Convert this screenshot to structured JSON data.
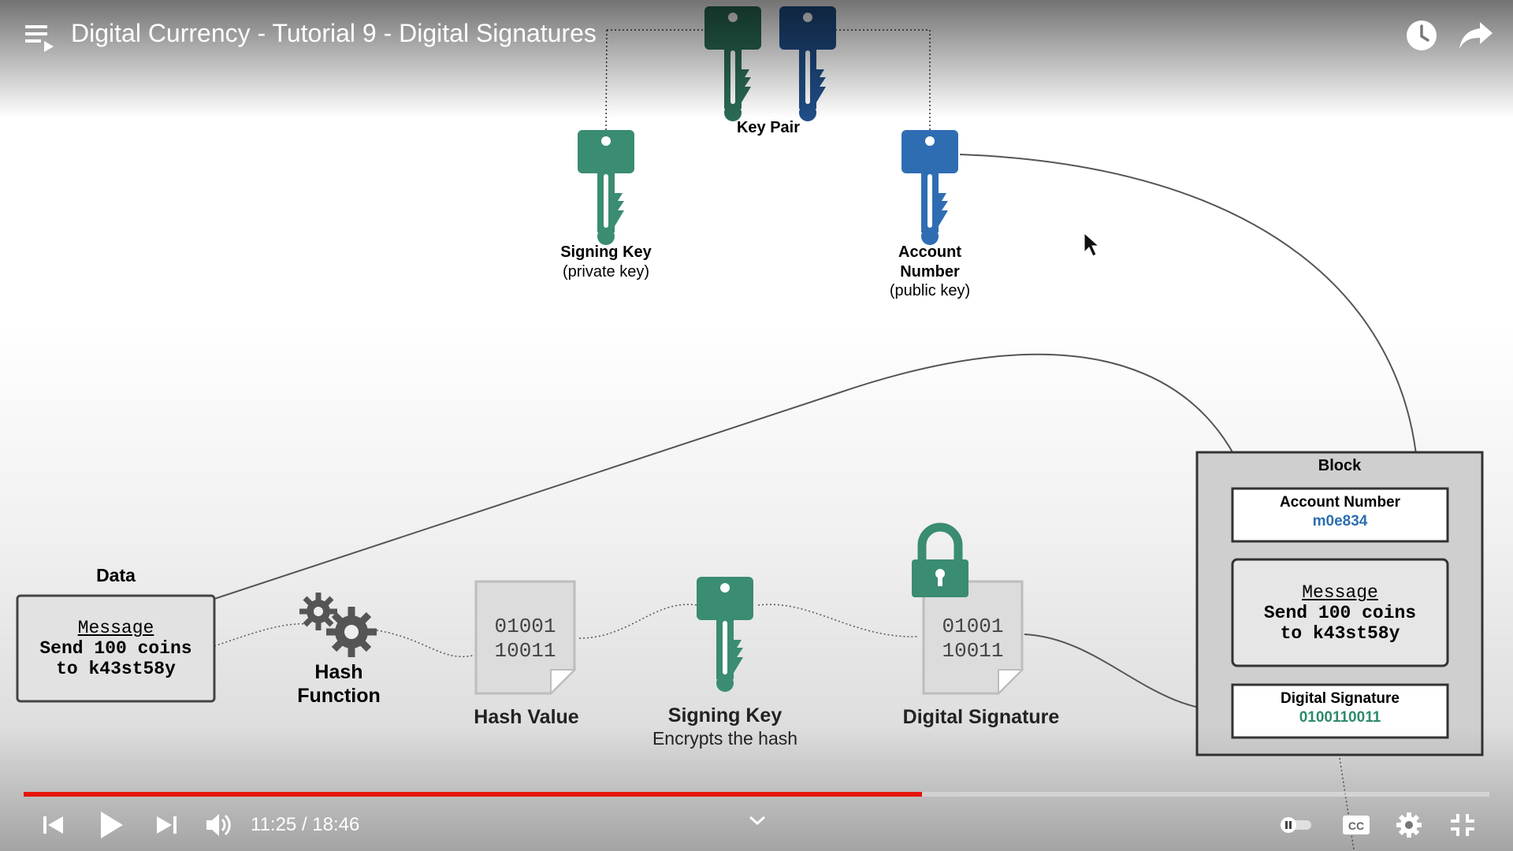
{
  "player": {
    "title": "Digital Currency - Tutorial 9 - Digital Signatures",
    "current_time": "11:25",
    "duration": "18:46",
    "time_text": "11:25 / 18:46",
    "progress": 0.613,
    "buffered": 0.639,
    "accent_color": "#e5150c"
  },
  "icons": {
    "playlist": "playlist-icon",
    "watch_later": "clock-icon",
    "share": "share-arrow-icon",
    "prev": "skip-previous-icon",
    "play": "play-icon",
    "next": "skip-next-icon",
    "volume": "volume-icon",
    "chevron": "chevron-down-icon",
    "autoplay": "autoplay-toggle-icon",
    "captions": "cc-icon",
    "settings": "gear-icon",
    "fullscreen": "exit-fullscreen-icon",
    "cursor": "mouse-cursor-icon"
  },
  "diagram": {
    "key_pair_label": "Key Pair",
    "signing_key_title": "Signing Key",
    "signing_key_sub": "(private key)",
    "account_number_title_1": "Account",
    "account_number_title_2": "Number",
    "account_number_sub": "(public key)",
    "data_label": "Data",
    "data_message_heading": "Message",
    "data_message_line1": "Send 100 coins",
    "data_message_line2": "to k43st58y",
    "hash_function_line1": "Hash",
    "hash_function_line2": "Function",
    "hash_value_label": "Hash Value",
    "binary_line1": "01001",
    "binary_line2": "10011",
    "signing_key_step_title": "Signing Key",
    "signing_key_step_sub": "Encrypts the hash",
    "digital_signature_label": "Digital Signature",
    "block_title": "Block",
    "block_account_label": "Account Number",
    "block_account_value": "m0e834",
    "block_message_heading": "Message",
    "block_message_line1": "Send 100 coins",
    "block_message_line2": "to k43st58y",
    "block_signature_label": "Digital Signature",
    "block_signature_value": "0100110011",
    "colors": {
      "green_key": "#3a8c72",
      "dark_green_key": "#2a6a55",
      "blue_key": "#2f6db3",
      "dark_blue_key": "#1f4d85",
      "account_value": "#2c6fb0",
      "signature_value": "#2e8a6c"
    }
  }
}
